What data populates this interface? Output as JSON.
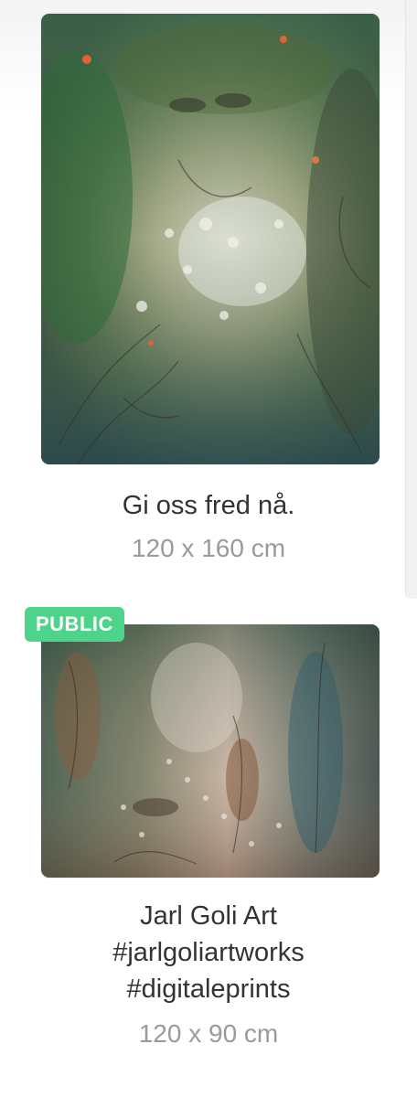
{
  "items": [
    {
      "title": "Gi oss fred nå.",
      "size": "120 x 160 cm",
      "colors": {
        "base": "#3d5a44",
        "light": "#d9d2bf",
        "accent": "#e0603a"
      }
    },
    {
      "badge": "PUBLIC",
      "title_lines": [
        "Jarl Goli Art",
        "#jarlgoliartworks",
        "#digitaleprints"
      ],
      "size": "120 x 90 cm",
      "colors": {
        "base": "#4a5a4e",
        "light": "#cdb8a6",
        "accent": "#b76a4a"
      }
    }
  ],
  "theme": {
    "badge_color": "#4ed48a",
    "title_color": "#333333",
    "subtitle_color": "#9a9a9a"
  }
}
